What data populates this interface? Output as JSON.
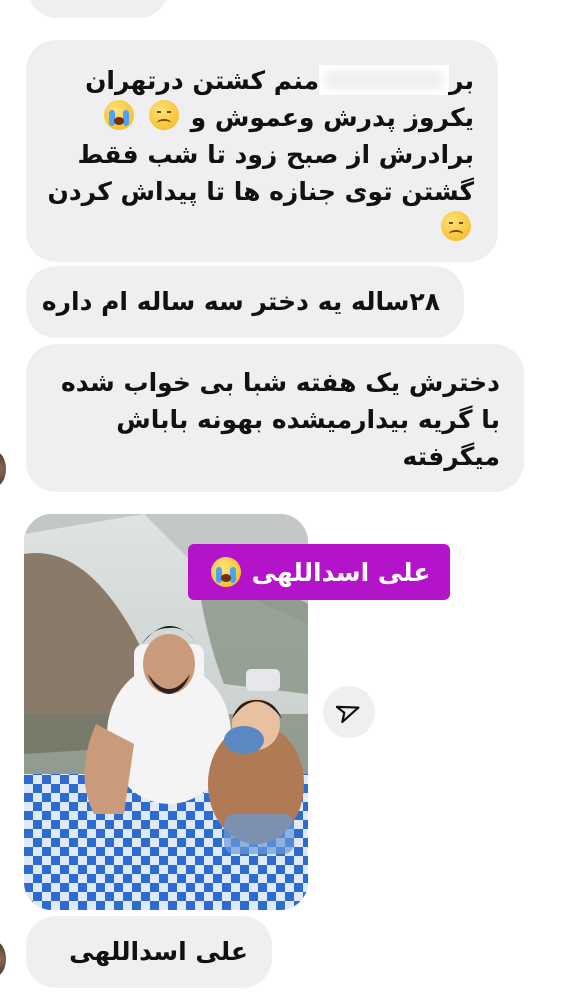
{
  "messages": [
    {
      "lines": [
        "بر[...] منم کشتن درتهران",
        "یکروز پدرش وعموش و",
        "برادرش از صبح زود تا شب فقط",
        "گشتن توی جنازه ها تا پیداش کردن"
      ],
      "line1_visible": "منم کشتن درتهران",
      "line1_start": "بر"
    },
    {
      "text": "۲۸ساله یه دختر سه ساله ام داره"
    },
    {
      "lines": [
        "دخترش یک هفته شبا بی خواب شده",
        "با گریه بیدارمیشده بهونه باباش",
        "میگرفته"
      ]
    }
  ],
  "photo": {
    "caption": "علی اسداللهی"
  },
  "final_message": "علی اسداللهی",
  "icons": [
    "sad-face-emoji",
    "crying-face-emoji",
    "send-icon"
  ],
  "colors": {
    "bubble": "#efeff1",
    "caption_chip": "#b414c9"
  }
}
